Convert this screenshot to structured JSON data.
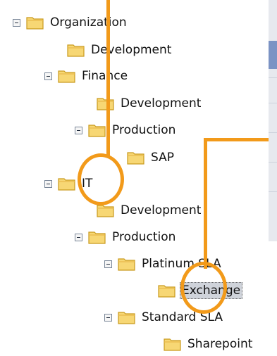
{
  "tree": {
    "nodes": [
      {
        "id": "organization",
        "label": "Organization",
        "expanded": true
      },
      {
        "id": "org-development",
        "label": "Development"
      },
      {
        "id": "finance",
        "label": "Finance",
        "expanded": true
      },
      {
        "id": "finance-development",
        "label": "Development"
      },
      {
        "id": "finance-production",
        "label": "Production",
        "expanded": true
      },
      {
        "id": "sap",
        "label": "SAP"
      },
      {
        "id": "it",
        "label": "IT",
        "expanded": true
      },
      {
        "id": "it-development",
        "label": "Development"
      },
      {
        "id": "it-production",
        "label": "Production",
        "expanded": true
      },
      {
        "id": "platinum-sla",
        "label": "Platinum SLA",
        "expanded": true
      },
      {
        "id": "exchange",
        "label": "Exchange",
        "selected": true
      },
      {
        "id": "standard-sla",
        "label": "Standard SLA",
        "expanded": true
      },
      {
        "id": "sharepoint",
        "label": "Sharepoint"
      }
    ]
  },
  "colors": {
    "callout": "#f29a1a",
    "folder_fill": "#f7d774",
    "folder_edge": "#c99a1d",
    "selection": "#cfd3da"
  }
}
